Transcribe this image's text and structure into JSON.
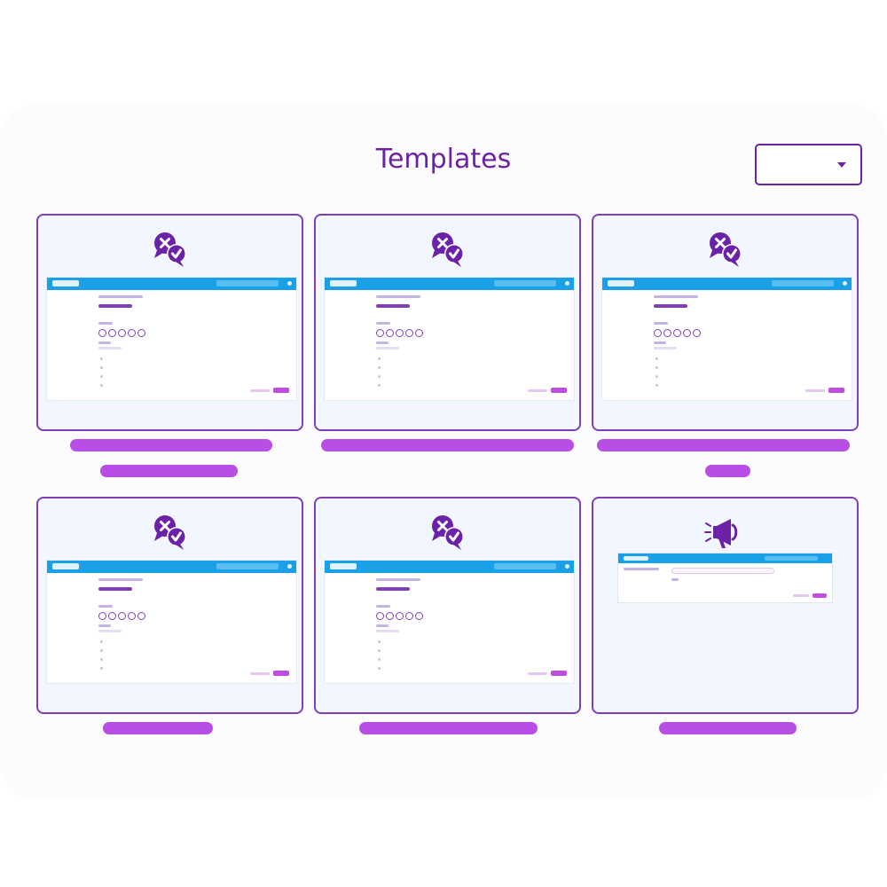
{
  "header": {
    "title": "Templates"
  },
  "filter": {
    "selected": ""
  },
  "cards": [
    {
      "icon": "poll-cross-check-icon"
    },
    {
      "icon": "poll-cross-check-icon"
    },
    {
      "icon": "poll-cross-check-icon"
    },
    {
      "icon": "poll-cross-check-icon"
    },
    {
      "icon": "poll-cross-check-icon"
    },
    {
      "icon": "megaphone-icon"
    }
  ],
  "colors": {
    "accent": "#6b21a8",
    "card_border": "#7e3fb8",
    "card_bg": "#f2f6fe",
    "caption_bar": "#b84ee6",
    "preview_header": "#1aa0e6"
  }
}
